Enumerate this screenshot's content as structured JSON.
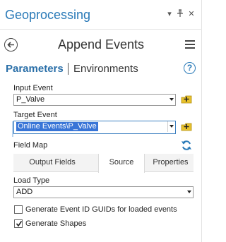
{
  "pane": {
    "title": "Geoprocessing",
    "dropdown_glyph": "▾",
    "pin_glyph": "⊥",
    "close_glyph": "✕"
  },
  "tool": {
    "title": "Append Events",
    "back_icon": "back-arrow-icon",
    "menu_icon": "hamburger-menu-icon"
  },
  "tabs": {
    "parameters": "Parameters",
    "environments": "Environments",
    "help_glyph": "?"
  },
  "params": {
    "input_event_label": "Input Event",
    "input_event_value": "P_Valve",
    "target_event_label": "Target Event",
    "target_event_value": "Online Events\\P_Valve",
    "field_map_label": "Field Map",
    "field_map_tabs": [
      "Output Fields",
      "Source",
      "Properties"
    ],
    "field_map_active_tab": "Source",
    "load_type_label": "Load Type",
    "load_type_value": "ADD",
    "checkboxes": [
      {
        "label": "Generate Event ID GUIDs for loaded events",
        "checked": false
      },
      {
        "label": "Generate Shapes",
        "checked": true
      }
    ]
  },
  "colors": {
    "accent": "#2a7ab8",
    "selection": "#3875d7",
    "add_icon_yellow": "#e8c22c"
  }
}
